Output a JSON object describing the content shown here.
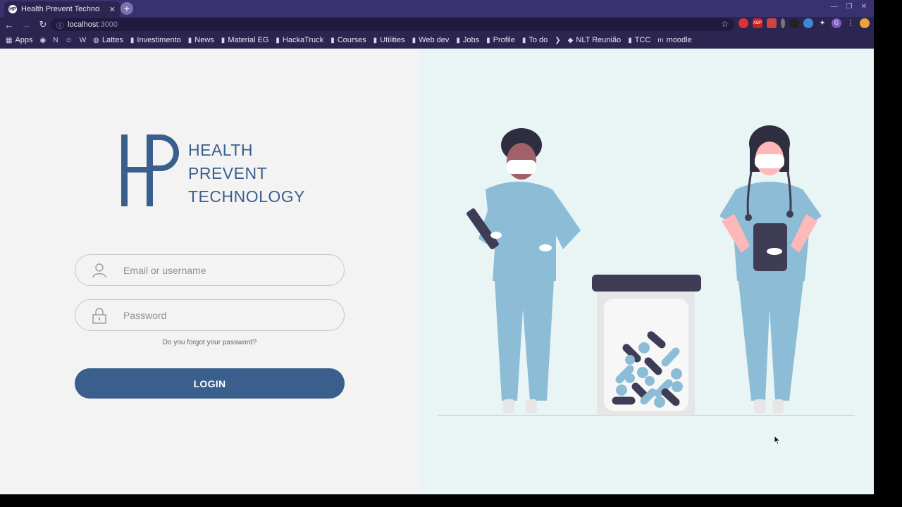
{
  "browser": {
    "tab_title": "Health Prevent Technolog",
    "tab_favicon": "HP",
    "url_host": "localhost",
    "url_port": ":3000",
    "bookmarks": [
      {
        "label": "Apps",
        "icon": "grid-icon"
      },
      {
        "label": "",
        "icon": "whatsapp-icon"
      },
      {
        "label": "",
        "icon": "netflix-icon"
      },
      {
        "label": "",
        "icon": "smile-icon"
      },
      {
        "label": "",
        "icon": "w-icon"
      },
      {
        "label": "Lattes",
        "icon": "globe-icon"
      },
      {
        "label": "Investimento",
        "icon": "folder-icon"
      },
      {
        "label": "News",
        "icon": "folder-icon"
      },
      {
        "label": "Material EG",
        "icon": "folder-icon"
      },
      {
        "label": "HackaTruck",
        "icon": "folder-icon"
      },
      {
        "label": "Courses",
        "icon": "folder-icon"
      },
      {
        "label": "Utilities",
        "icon": "folder-icon"
      },
      {
        "label": "Web dev",
        "icon": "folder-icon"
      },
      {
        "label": "Jobs",
        "icon": "folder-icon"
      },
      {
        "label": "Profile",
        "icon": "folder-icon"
      },
      {
        "label": "To do",
        "icon": "folder-icon"
      },
      {
        "label": "",
        "icon": "vscode-icon"
      },
      {
        "label": "NLT Reunião",
        "icon": "teams-icon"
      },
      {
        "label": "TCC",
        "icon": "folder-icon"
      },
      {
        "label": "moodle",
        "icon": "moodle-icon"
      }
    ]
  },
  "brand": {
    "monogram": "HP",
    "line1": "HEALTH",
    "line2": "PREVENT",
    "line3": "TECHNOLOGY",
    "color": "#3a5f8c"
  },
  "login": {
    "email_placeholder": "Email or username",
    "password_placeholder": "Password",
    "forgot_label": "Do you forgot your password?",
    "button_label": "LOGIN"
  }
}
